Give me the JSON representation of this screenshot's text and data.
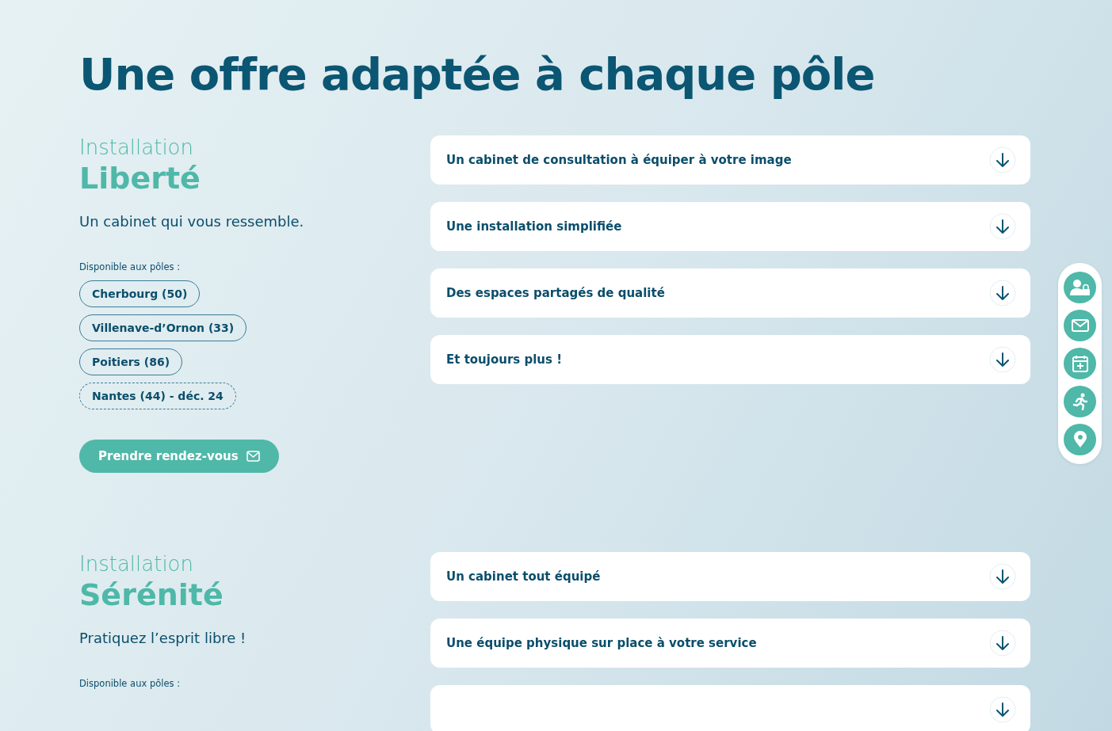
{
  "heading": "Une offre adaptée à chaque pôle",
  "sections": [
    {
      "kicker": "Installation",
      "name": "Liberté",
      "tagline": "Un cabinet qui vous ressemble.",
      "poles_label": "Disponible aux pôles :",
      "poles": [
        {
          "label": "Cherbourg (50)",
          "upcoming": false
        },
        {
          "label": "Villenave-d’Ornon (33)",
          "upcoming": false
        },
        {
          "label": "Poitiers (86)",
          "upcoming": false
        },
        {
          "label": "Nantes (44) - déc. 24",
          "upcoming": true
        }
      ],
      "button": "Prendre rendez-vous",
      "items": [
        {
          "title": "Un cabinet de consultation à équiper à votre image"
        },
        {
          "title": "Une installation simplifiée"
        },
        {
          "title": "Des espaces partagés de qualité"
        },
        {
          "title": "Et toujours plus !"
        }
      ]
    },
    {
      "kicker": "Installation",
      "name": "Sérénité",
      "tagline": "Pratiquez l’esprit libre !",
      "poles_label": "Disponible aux pôles :",
      "items": [
        {
          "title": "Un cabinet tout équipé"
        },
        {
          "title": "Une équipe physique sur place à votre service"
        },
        {
          "kind": "cut_off"
        }
      ]
    }
  ],
  "quick_links": [
    {
      "kind": "account"
    },
    {
      "kind": "mail"
    },
    {
      "kind": "calendar"
    },
    {
      "kind": "run"
    },
    {
      "kind": "pin"
    }
  ]
}
